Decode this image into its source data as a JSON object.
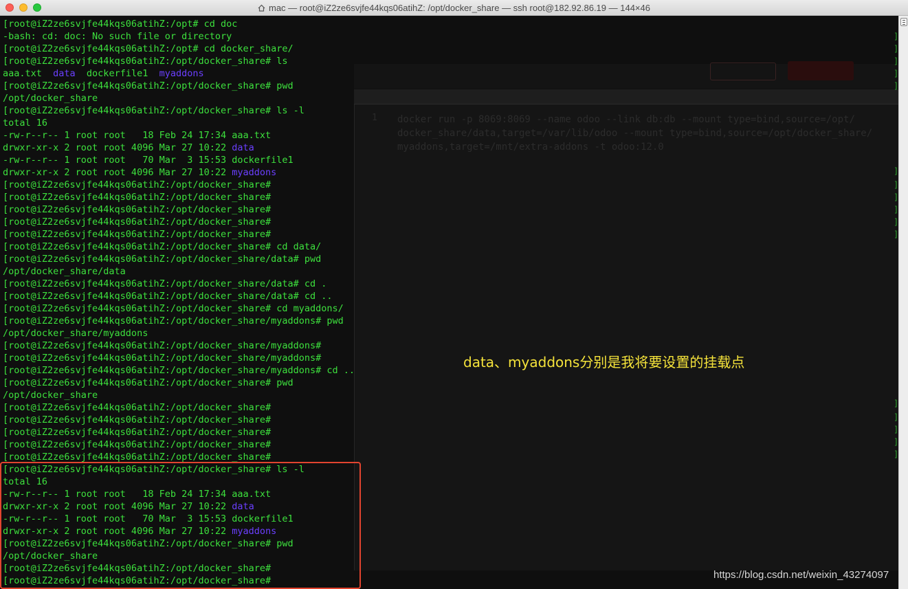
{
  "window": {
    "title": "mac — root@iZ2ze6svjfe44kqs06atihZ: /opt/docker_share — ssh root@182.92.86.19 — 144×46"
  },
  "terminal": {
    "lines": [
      [
        {
          "t": "[root@iZ2ze6svjfe44kqs06atihZ:/opt# cd doc"
        }
      ],
      [
        {
          "t": "-bash: cd: doc: No such file or directory"
        }
      ],
      [
        {
          "t": "[root@iZ2ze6svjfe44kqs06atihZ:/opt# cd docker_share/"
        }
      ],
      [
        {
          "t": "[root@iZ2ze6svjfe44kqs06atihZ:/opt/docker_share# ls"
        }
      ],
      [
        {
          "t": "aaa.txt  "
        },
        {
          "t": "data",
          "c": "dir"
        },
        {
          "t": "  dockerfile1  "
        },
        {
          "t": "myaddons",
          "c": "dir"
        }
      ],
      [
        {
          "t": "[root@iZ2ze6svjfe44kqs06atihZ:/opt/docker_share# pwd"
        }
      ],
      [
        {
          "t": "/opt/docker_share"
        }
      ],
      [
        {
          "t": "[root@iZ2ze6svjfe44kqs06atihZ:/opt/docker_share# ls -l"
        }
      ],
      [
        {
          "t": "total 16"
        }
      ],
      [
        {
          "t": "-rw-r--r-- 1 root root   18 Feb 24 17:34 aaa.txt"
        }
      ],
      [
        {
          "t": "drwxr-xr-x 2 root root 4096 Mar 27 10:22 "
        },
        {
          "t": "data",
          "c": "dir"
        }
      ],
      [
        {
          "t": "-rw-r--r-- 1 root root   70 Mar  3 15:53 dockerfile1"
        }
      ],
      [
        {
          "t": "drwxr-xr-x 2 root root 4096 Mar 27 10:22 "
        },
        {
          "t": "myaddons",
          "c": "dir"
        }
      ],
      [
        {
          "t": "[root@iZ2ze6svjfe44kqs06atihZ:/opt/docker_share#"
        }
      ],
      [
        {
          "t": "[root@iZ2ze6svjfe44kqs06atihZ:/opt/docker_share#"
        }
      ],
      [
        {
          "t": "[root@iZ2ze6svjfe44kqs06atihZ:/opt/docker_share#"
        }
      ],
      [
        {
          "t": "[root@iZ2ze6svjfe44kqs06atihZ:/opt/docker_share#"
        }
      ],
      [
        {
          "t": "[root@iZ2ze6svjfe44kqs06atihZ:/opt/docker_share#"
        }
      ],
      [
        {
          "t": "[root@iZ2ze6svjfe44kqs06atihZ:/opt/docker_share# cd data/"
        }
      ],
      [
        {
          "t": "[root@iZ2ze6svjfe44kqs06atihZ:/opt/docker_share/data# pwd"
        }
      ],
      [
        {
          "t": "/opt/docker_share/data"
        }
      ],
      [
        {
          "t": "[root@iZ2ze6svjfe44kqs06atihZ:/opt/docker_share/data# cd ."
        }
      ],
      [
        {
          "t": "[root@iZ2ze6svjfe44kqs06atihZ:/opt/docker_share/data# cd .."
        }
      ],
      [
        {
          "t": "[root@iZ2ze6svjfe44kqs06atihZ:/opt/docker_share# cd myaddons/"
        }
      ],
      [
        {
          "t": "[root@iZ2ze6svjfe44kqs06atihZ:/opt/docker_share/myaddons# pwd"
        }
      ],
      [
        {
          "t": "/opt/docker_share/myaddons"
        }
      ],
      [
        {
          "t": "[root@iZ2ze6svjfe44kqs06atihZ:/opt/docker_share/myaddons#"
        }
      ],
      [
        {
          "t": "[root@iZ2ze6svjfe44kqs06atihZ:/opt/docker_share/myaddons#"
        }
      ],
      [
        {
          "t": "[root@iZ2ze6svjfe44kqs06atihZ:/opt/docker_share/myaddons# cd .."
        }
      ],
      [
        {
          "t": "[root@iZ2ze6svjfe44kqs06atihZ:/opt/docker_share# pwd"
        }
      ],
      [
        {
          "t": "/opt/docker_share"
        }
      ],
      [
        {
          "t": "[root@iZ2ze6svjfe44kqs06atihZ:/opt/docker_share#"
        }
      ],
      [
        {
          "t": "[root@iZ2ze6svjfe44kqs06atihZ:/opt/docker_share#"
        }
      ],
      [
        {
          "t": "[root@iZ2ze6svjfe44kqs06atihZ:/opt/docker_share#"
        }
      ],
      [
        {
          "t": "[root@iZ2ze6svjfe44kqs06atihZ:/opt/docker_share#"
        }
      ],
      [
        {
          "t": "[root@iZ2ze6svjfe44kqs06atihZ:/opt/docker_share#"
        }
      ],
      [
        {
          "t": "[root@iZ2ze6svjfe44kqs06atihZ:/opt/docker_share# ls -l"
        }
      ],
      [
        {
          "t": "total 16"
        }
      ],
      [
        {
          "t": "-rw-r--r-- 1 root root   18 Feb 24 17:34 aaa.txt"
        }
      ],
      [
        {
          "t": "drwxr-xr-x 2 root root 4096 Mar 27 10:22 "
        },
        {
          "t": "data",
          "c": "dir"
        }
      ],
      [
        {
          "t": "-rw-r--r-- 1 root root   70 Mar  3 15:53 dockerfile1"
        }
      ],
      [
        {
          "t": "drwxr-xr-x 2 root root 4096 Mar 27 10:22 "
        },
        {
          "t": "myaddons",
          "c": "dir"
        }
      ],
      [
        {
          "t": "[root@iZ2ze6svjfe44kqs06atihZ:/opt/docker_share# pwd"
        }
      ],
      [
        {
          "t": "/opt/docker_share"
        }
      ],
      [
        {
          "t": "[root@iZ2ze6svjfe44kqs06atihZ:/opt/docker_share#"
        }
      ],
      [
        {
          "t": "[root@iZ2ze6svjfe44kqs06atihZ:/opt/docker_share#"
        }
      ]
    ]
  },
  "background_editor": {
    "line_number": "1",
    "code": "docker run -p 8069:8069 --name odoo --link db:db --mount type=bind,source=/opt/\ndocker_share/data,target=/var/lib/odoo --mount type=bind,source=/opt/docker_share/\nmyaddons,target=/mnt/extra-addons -t odoo:12.0"
  },
  "annotation": {
    "text": "data、myaddons分别是我将要设置的挂载点"
  },
  "watermark": {
    "text": "https://blog.csdn.net/weixin_43274097"
  },
  "colors": {
    "terminal_text": "#3de13d",
    "directory": "#6b3fff",
    "annotation": "#f5e33a",
    "highlight_box": "#e2442f"
  }
}
